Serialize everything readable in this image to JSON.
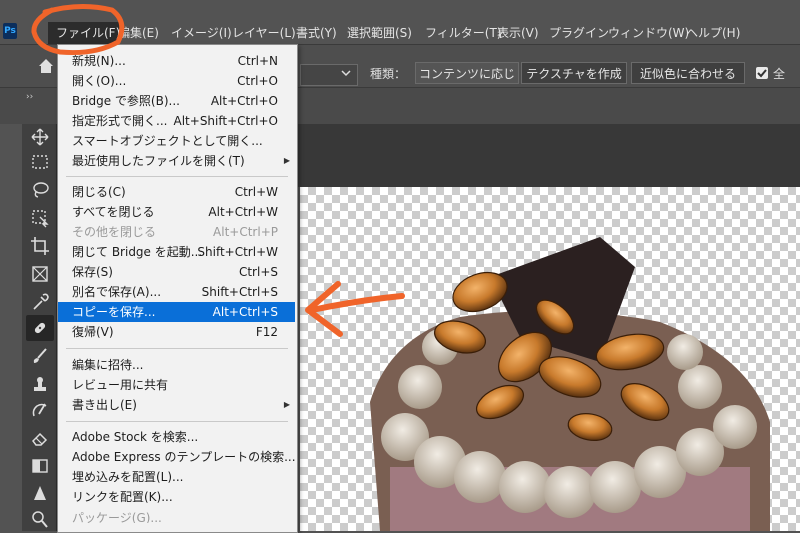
{
  "app": {
    "logo_text": "Ps"
  },
  "menubar": {
    "items": [
      "ファイル(F)",
      "編集(E)",
      "イメージ(I)",
      "レイヤー(L)",
      "書式(Y)",
      "選択範囲(S)",
      "フィルター(T)",
      "表示(V)",
      "プラグイン",
      "ウィンドウ(W)",
      "ヘルプ(H)"
    ]
  },
  "options_bar": {
    "type_label": "種類：",
    "segments": [
      "コンテンツに応じる",
      "テクスチャを作成",
      "近似色に合わせる"
    ],
    "active_segment": 0,
    "sample_label": "全",
    "collapse_glyph": "››"
  },
  "file_menu": {
    "groups": [
      [
        {
          "label": "新規(N)...",
          "shortcut": "Ctrl+N"
        },
        {
          "label": "開く(O)...",
          "shortcut": "Ctrl+O"
        },
        {
          "label": "Bridge で参照(B)...",
          "shortcut": "Alt+Ctrl+O"
        },
        {
          "label": "指定形式で開く...",
          "shortcut": "Alt+Shift+Ctrl+O"
        },
        {
          "label": "スマートオブジェクトとして開く...",
          "shortcut": ""
        },
        {
          "label": "最近使用したファイルを開く(T)",
          "shortcut": "",
          "submenu": true
        }
      ],
      [
        {
          "label": "閉じる(C)",
          "shortcut": "Ctrl+W"
        },
        {
          "label": "すべてを閉じる",
          "shortcut": "Alt+Ctrl+W"
        },
        {
          "label": "その他を閉じる",
          "shortcut": "Alt+Ctrl+P",
          "disabled": true
        },
        {
          "label": "閉じて Bridge を起動...",
          "shortcut": "Shift+Ctrl+W"
        },
        {
          "label": "保存(S)",
          "shortcut": "Ctrl+S"
        },
        {
          "label": "別名で保存(A)...",
          "shortcut": "Shift+Ctrl+S"
        },
        {
          "label": "コピーを保存...",
          "shortcut": "Alt+Ctrl+S",
          "highlighted": true
        },
        {
          "label": "復帰(V)",
          "shortcut": "F12"
        }
      ],
      [
        {
          "label": "編集に招待...",
          "shortcut": ""
        },
        {
          "label": "レビュー用に共有",
          "shortcut": ""
        },
        {
          "label": "書き出し(E)",
          "shortcut": "",
          "submenu": true
        }
      ],
      [
        {
          "label": "Adobe Stock を検索...",
          "shortcut": ""
        },
        {
          "label": "Adobe Express のテンプレートの検索...",
          "shortcut": ""
        },
        {
          "label": "埋め込みを配置(L)...",
          "shortcut": ""
        },
        {
          "label": "リンクを配置(K)...",
          "shortcut": ""
        },
        {
          "label": "パッケージ(G)...",
          "shortcut": "",
          "disabled": true
        }
      ]
    ],
    "submenu_glyph": "▶"
  },
  "colors": {
    "highlight": "#0a6fd8",
    "annotation": "#f0642a",
    "menubar_bg": "#535353",
    "menu_bg": "#f2f2f2"
  },
  "icons": [
    "home-icon",
    "move-icon",
    "marquee-icon",
    "lasso-icon",
    "object-select-icon",
    "crop-icon",
    "frame-icon",
    "eyedropper-icon",
    "spot-healing-icon",
    "brush-icon",
    "stamp-icon",
    "history-brush-icon",
    "eraser-icon",
    "gradient-icon",
    "sharpen-icon",
    "dodge-icon"
  ]
}
